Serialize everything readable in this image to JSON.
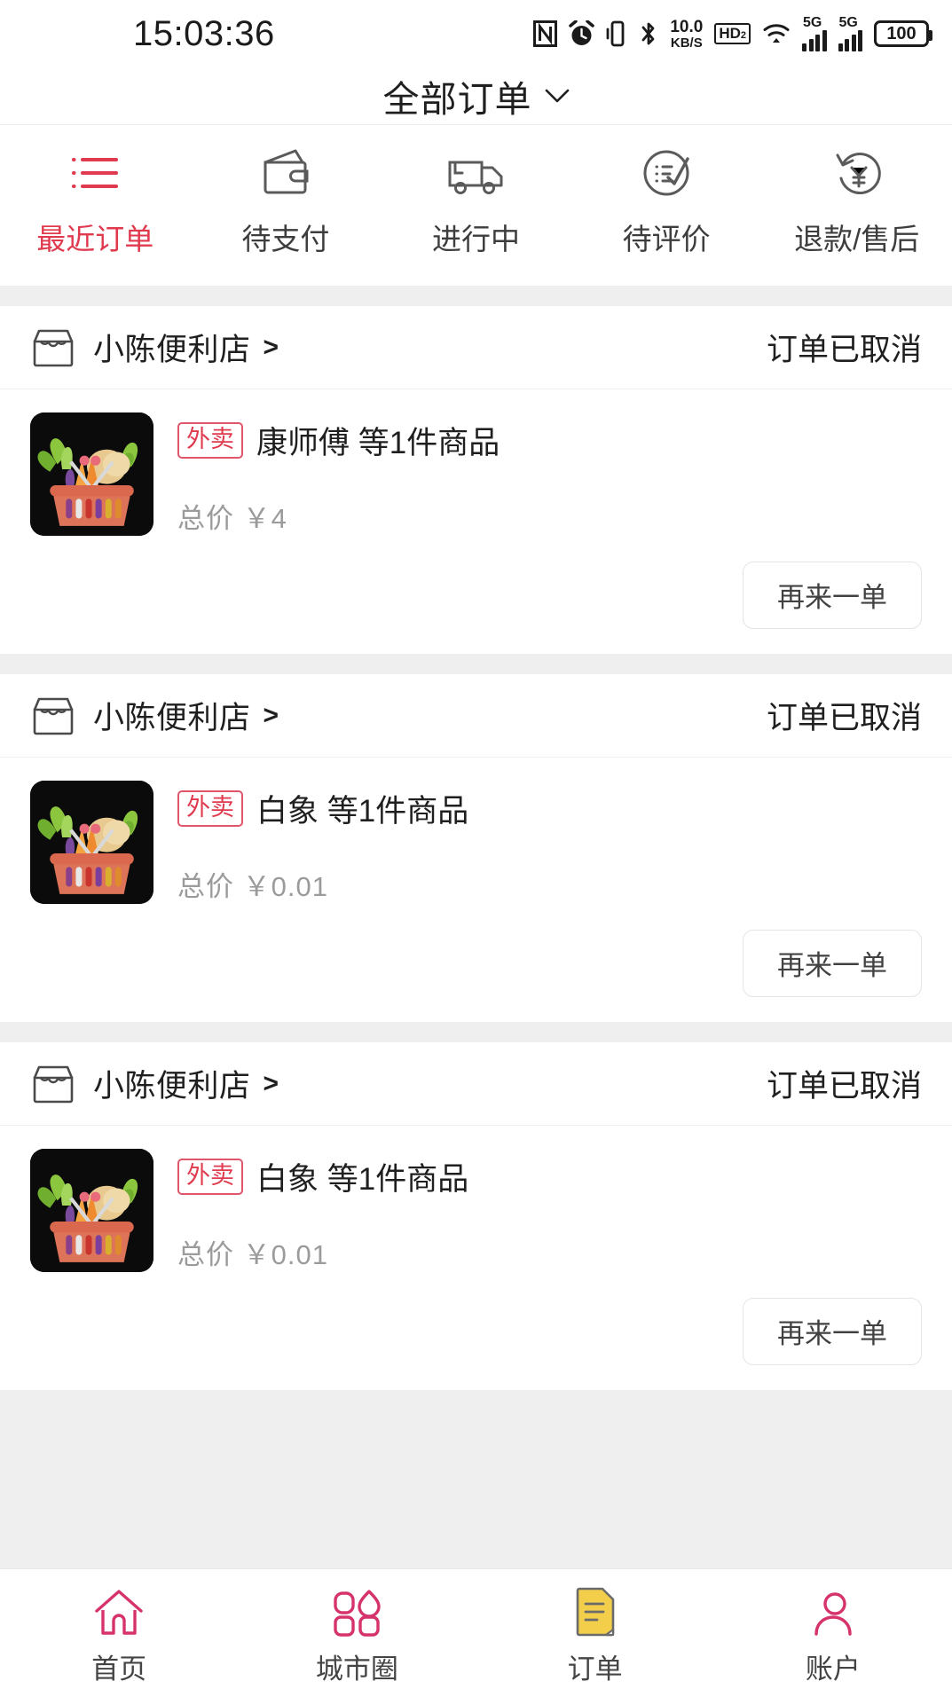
{
  "statusbar": {
    "time": "15:03:36",
    "icons": [
      "nfc-icon",
      "alarm-icon",
      "vibrate-icon",
      "bluetooth-icon"
    ],
    "network_speed_value": "10.0",
    "network_speed_unit": "KB/S",
    "hd_label": "HD",
    "hd_sub": "2",
    "signal1_label": "5G",
    "signal2_label": "5G",
    "battery": "100"
  },
  "header": {
    "title": "全部订单",
    "dropdown_icon": "chevron-down-icon"
  },
  "tabs": [
    {
      "label": "最近订单",
      "icon": "list-icon",
      "active": true
    },
    {
      "label": "待支付",
      "icon": "wallet-icon",
      "active": false
    },
    {
      "label": "进行中",
      "icon": "truck-icon",
      "active": false
    },
    {
      "label": "待评价",
      "icon": "review-icon",
      "active": false
    },
    {
      "label": "退款/售后",
      "icon": "refund-icon",
      "active": false
    }
  ],
  "orders": [
    {
      "shop_name": "小陈便利店",
      "shop_arrow": ">",
      "status": "订单已取消",
      "badge": "外卖",
      "product": "康师傅 等1件商品",
      "price_label": "总价",
      "price": "￥4",
      "action_label": "再来一单",
      "thumb_icon": "vegetable-basket-image"
    },
    {
      "shop_name": "小陈便利店",
      "shop_arrow": ">",
      "status": "订单已取消",
      "badge": "外卖",
      "product": "白象 等1件商品",
      "price_label": "总价",
      "price": "￥0.01",
      "action_label": "再来一单",
      "thumb_icon": "vegetable-basket-image"
    },
    {
      "shop_name": "小陈便利店",
      "shop_arrow": ">",
      "status": "订单已取消",
      "badge": "外卖",
      "product": "白象 等1件商品",
      "price_label": "总价",
      "price": "￥0.01",
      "action_label": "再来一单",
      "thumb_icon": "vegetable-basket-image"
    }
  ],
  "bottomnav": [
    {
      "label": "首页",
      "icon": "home-icon",
      "active": false
    },
    {
      "label": "城市圈",
      "icon": "city-icon",
      "active": false
    },
    {
      "label": "订单",
      "icon": "order-icon",
      "active": true
    },
    {
      "label": "账户",
      "icon": "account-icon",
      "active": false
    }
  ],
  "colors": {
    "accent_red": "#e03a4e",
    "nav_pink": "#d6336c",
    "order_yellow": "#f2ce4b",
    "divider_gray": "#efeff0",
    "muted_text": "#9b9b9b"
  }
}
